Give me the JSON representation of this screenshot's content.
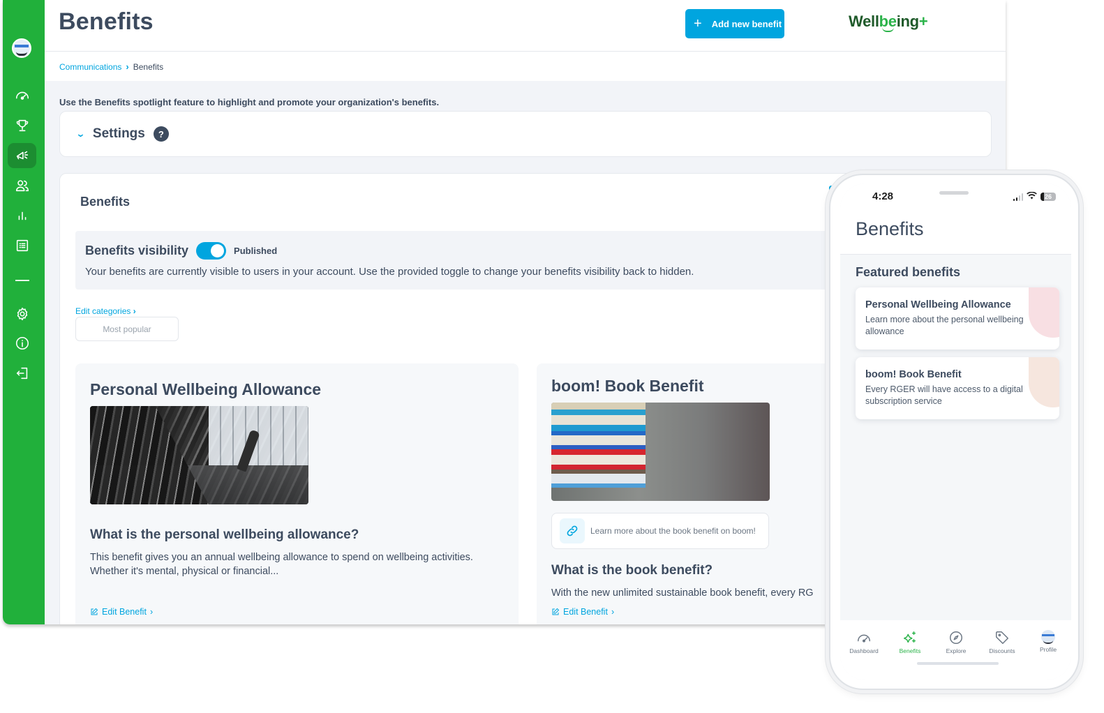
{
  "app": {
    "header": {
      "title": "Benefits",
      "add_button_label": "Add new benefit",
      "brand": {
        "prefix": "Well",
        "highlight": "be",
        "suffix": "ing",
        "plus": "+"
      }
    },
    "breadcrumb": [
      {
        "label": "Communications",
        "link": true
      },
      {
        "label": "Benefits",
        "link": false
      }
    ],
    "sidebar": {
      "items": [
        {
          "name": "dashboard",
          "icon": "gauge-icon",
          "active": false
        },
        {
          "name": "awards",
          "icon": "trophy-icon",
          "active": false
        },
        {
          "name": "communications",
          "icon": "megaphone-icon",
          "active": true
        },
        {
          "name": "users",
          "icon": "users-icon",
          "active": false
        },
        {
          "name": "analytics",
          "icon": "bar-chart-icon",
          "active": false
        },
        {
          "name": "reports",
          "icon": "list-icon",
          "active": false
        },
        {
          "name": "settings",
          "icon": "gear-icon",
          "active": false
        },
        {
          "name": "info",
          "icon": "info-icon",
          "active": false
        },
        {
          "name": "logout",
          "icon": "logout-icon",
          "active": false
        }
      ]
    },
    "intro_text": "Use the Benefits spotlight feature to highlight and promote your organization's benefits.",
    "settings": {
      "label": "Settings",
      "help": "?"
    },
    "benefits_panel": {
      "title": "Benefits",
      "visibility": {
        "label": "Benefits visibility",
        "toggle_on": true,
        "state": "Published",
        "description": "Your benefits are currently visible to users in your account. Use the provided toggle to change your benefits visibility back to hidden."
      },
      "edit_categories": "Edit categories",
      "categories": [
        "Most popular"
      ],
      "cards": [
        {
          "title": "Personal Wellbeing Allowance",
          "image": "gym",
          "subtitle": "What is the personal wellbeing allowance?",
          "description_lines": [
            "This benefit gives you an annual wellbeing allowance to spend on wellbeing activities.",
            "Whether it's mental, physical or financial..."
          ],
          "edit_label": "Edit Benefit"
        },
        {
          "title": "boom! Book Benefit",
          "image": "books",
          "link_text": "Learn more about the book benefit on boom!",
          "subtitle": "What is the book benefit?",
          "description_lines": [
            "With the new unlimited sustainable book benefit, every RG"
          ],
          "edit_label": "Edit Benefit"
        }
      ]
    },
    "colors": {
      "sidebar": "#21b03b",
      "accent": "#00a5df",
      "text": "#3d4b5f"
    }
  },
  "phone": {
    "status": {
      "time": "4:28",
      "battery": "26"
    },
    "title": "Benefits",
    "section_title": "Featured benefits",
    "cards": [
      {
        "title": "Personal Wellbeing Allowance",
        "description": "Learn more about the personal wellbeing allowance",
        "accent": "#f8dfe3"
      },
      {
        "title": "boom! Book Benefit",
        "description": "Every RGER will have access to a digital subscription service",
        "accent": "#f6e6de"
      }
    ],
    "tabs": [
      {
        "label": "Dashboard",
        "icon": "gauge-icon",
        "active": false
      },
      {
        "label": "Benefits",
        "icon": "sparkles-icon",
        "active": true
      },
      {
        "label": "Explore",
        "icon": "compass-icon",
        "active": false
      },
      {
        "label": "Discounts",
        "icon": "tag-icon",
        "active": false
      },
      {
        "label": "Profile",
        "icon": "avatar-icon",
        "active": false
      }
    ]
  }
}
